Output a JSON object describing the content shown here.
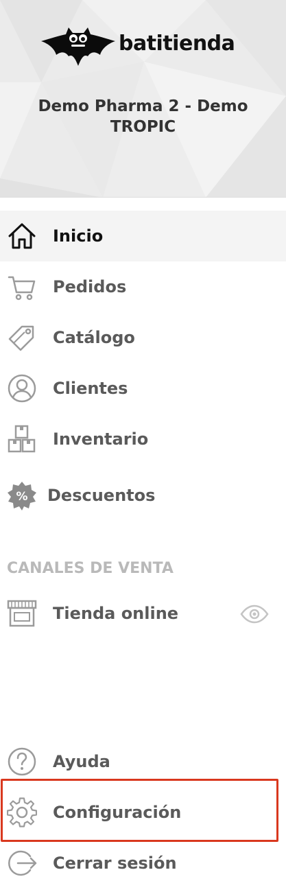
{
  "brand": {
    "name": "batitienda",
    "logo_icon": "bat-logo-icon"
  },
  "store": {
    "name": "Demo Pharma 2 - Demo TROPIC"
  },
  "nav": {
    "items": [
      {
        "label": "Inicio",
        "icon": "home-icon",
        "active": true
      },
      {
        "label": "Pedidos",
        "icon": "cart-icon",
        "active": false
      },
      {
        "label": "Catálogo",
        "icon": "tag-icon",
        "active": false
      },
      {
        "label": "Clientes",
        "icon": "user-circle-icon",
        "active": false
      },
      {
        "label": "Inventario",
        "icon": "boxes-icon",
        "active": false
      },
      {
        "label": "Descuentos",
        "icon": "percent-badge-icon",
        "active": false
      }
    ]
  },
  "sales_channels": {
    "title": "CANALES DE VENTA",
    "items": [
      {
        "label": "Tienda online",
        "icon": "storefront-icon",
        "action_icon": "eye-icon"
      }
    ]
  },
  "footer_nav": {
    "items": [
      {
        "label": "Ayuda",
        "icon": "help-circle-icon"
      },
      {
        "label": "Configuración",
        "icon": "gear-icon",
        "highlighted": true
      },
      {
        "label": "Cerrar sesión",
        "icon": "logout-icon"
      }
    ]
  },
  "colors": {
    "highlight_border": "#d9381e",
    "active_bg": "#f4f4f4",
    "header_bg": "#ececec",
    "section_title": "#b9b9b9"
  }
}
